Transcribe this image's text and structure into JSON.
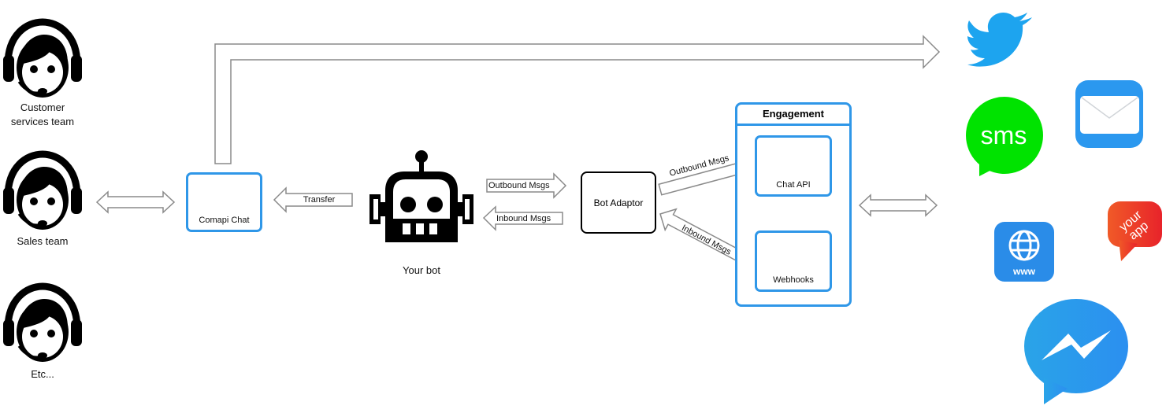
{
  "teams": [
    {
      "label_lines": [
        "Customer",
        "services team"
      ]
    },
    {
      "label_lines": [
        "Sales team"
      ]
    },
    {
      "label_lines": [
        "Etc..."
      ]
    }
  ],
  "comapi_chat": {
    "label": "Comapi Chat"
  },
  "bot": {
    "label": "Your bot"
  },
  "bot_adaptor": {
    "label": "Bot Adaptor"
  },
  "engagement": {
    "title": "Engagement",
    "chat_api": {
      "label": "Chat API"
    },
    "webhooks": {
      "label": "Webhooks"
    }
  },
  "arrows": {
    "transfer": "Transfer",
    "outbound_bot": "Outbound Msgs",
    "inbound_bot": "Inbound Msgs",
    "outbound_engagement": "Outbound Msgs",
    "inbound_engagement": "Inbound Msgs"
  },
  "channels": {
    "twitter": "twitter-icon",
    "sms": {
      "icon": "sms-icon",
      "text": "sms"
    },
    "email": "email-icon",
    "web": {
      "icon": "web-icon",
      "text": "www"
    },
    "your_app": {
      "icon": "your-app-icon",
      "text_lines": [
        "your",
        "app"
      ]
    },
    "messenger": "messenger-icon"
  },
  "colors": {
    "accent_blue": "#2f97e8",
    "arrow_gray": "#7f7f7f",
    "twitter": "#1da1f2",
    "sms": "#00e000",
    "email": "#2b98ef",
    "web": "#2a8ce8",
    "your_app": "#e8402a",
    "messenger": "#2196f3"
  }
}
